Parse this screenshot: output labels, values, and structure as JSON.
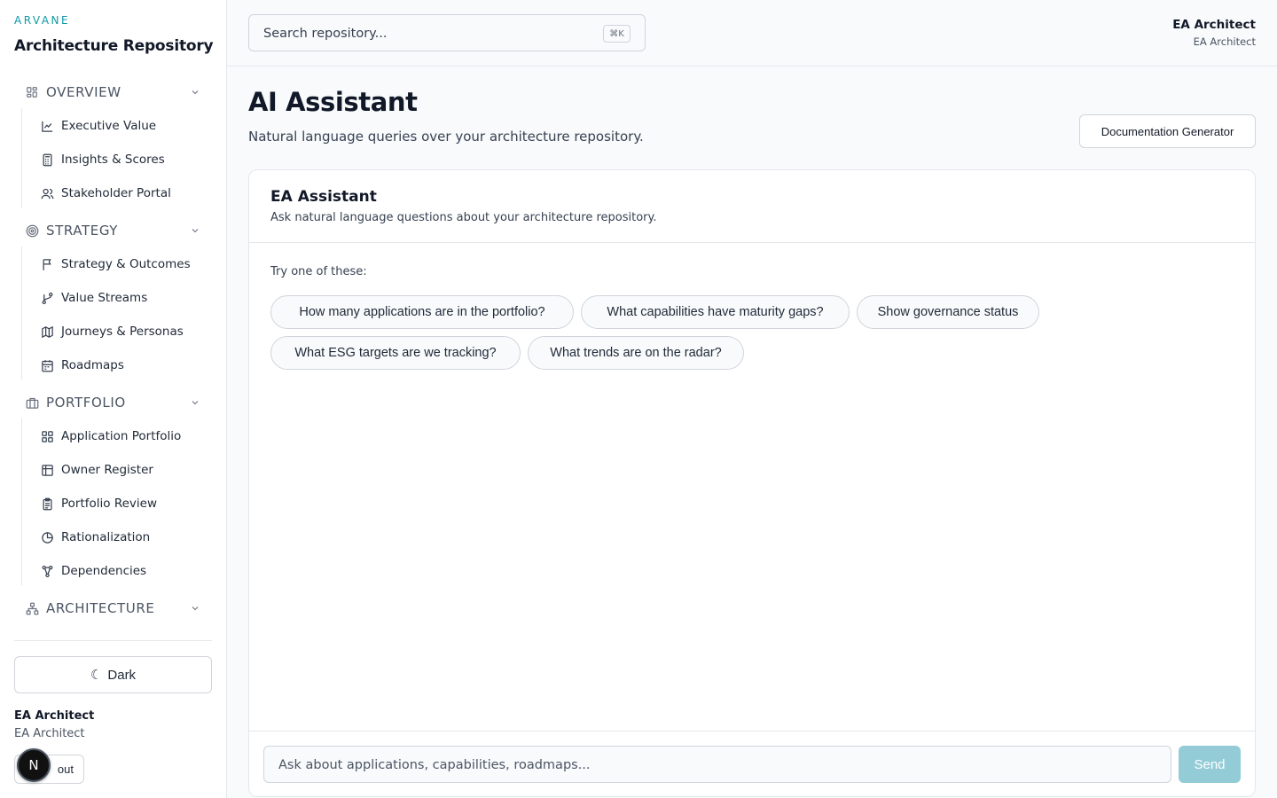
{
  "brand": {
    "small": "ARVANE",
    "title": "Architecture Repository"
  },
  "sidebar": {
    "sections": [
      {
        "label": "OVERVIEW",
        "icon": "dashboard-grid-icon",
        "items": [
          {
            "label": "Executive Value",
            "icon": "line-chart-icon"
          },
          {
            "label": "Insights & Scores",
            "icon": "calculator-icon"
          },
          {
            "label": "Stakeholder Portal",
            "icon": "users-icon"
          }
        ]
      },
      {
        "label": "STRATEGY",
        "icon": "target-icon",
        "items": [
          {
            "label": "Strategy & Outcomes",
            "icon": "flag-icon"
          },
          {
            "label": "Value Streams",
            "icon": "git-branch-icon"
          },
          {
            "label": "Journeys & Personas",
            "icon": "map-icon"
          },
          {
            "label": "Roadmaps",
            "icon": "calendar-icon"
          }
        ]
      },
      {
        "label": "PORTFOLIO",
        "icon": "briefcase-icon",
        "items": [
          {
            "label": "Application Portfolio",
            "icon": "apps-grid-icon"
          },
          {
            "label": "Owner Register",
            "icon": "table-icon"
          },
          {
            "label": "Portfolio Review",
            "icon": "clipboard-icon"
          },
          {
            "label": "Rationalization",
            "icon": "pie-chart-icon"
          },
          {
            "label": "Dependencies",
            "icon": "network-icon"
          }
        ]
      },
      {
        "label": "ARCHITECTURE",
        "icon": "sitemap-icon",
        "items": []
      }
    ],
    "theme_toggle": {
      "glyph": "☾",
      "label": "Dark"
    },
    "user": {
      "name": "EA Architect",
      "role": "EA Architect"
    },
    "signout_label": "out",
    "badge_letter": "N"
  },
  "topbar": {
    "search_placeholder": "Search repository...",
    "shortcut": "⌘K",
    "user": {
      "name": "EA Architect",
      "role": "EA Architect"
    }
  },
  "page": {
    "title": "AI Assistant",
    "subtitle": "Natural language queries over your architecture repository.",
    "doc_button": "Documentation Generator"
  },
  "assistant": {
    "title": "EA Assistant",
    "description": "Ask natural language questions about your architecture repository.",
    "try_label": "Try one of these:",
    "suggestions": [
      "How many applications are in the portfolio?",
      "What capabilities have maturity gaps?",
      "Show governance status",
      "What ESG targets are we tracking?",
      "What trends are on the radar?"
    ],
    "input_placeholder": "Ask about applications, capabilities, roadmaps...",
    "send_label": "Send"
  },
  "colors": {
    "accent": "#0e9aa7",
    "send_button": "#93ccd6"
  }
}
